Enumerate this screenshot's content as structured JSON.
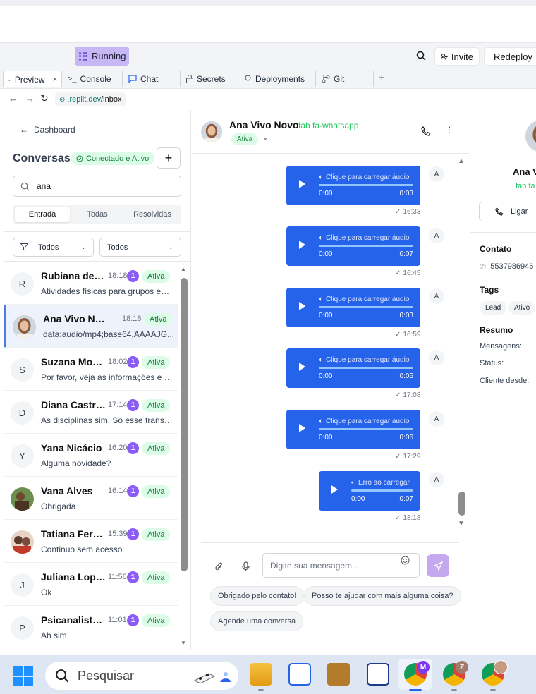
{
  "replit": {
    "running_label": "Running",
    "invite_label": "Invite",
    "redeploy_label": "Redeploy",
    "tabs": [
      {
        "label": "Preview"
      },
      {
        "label": "Console"
      },
      {
        "label": "Chat"
      },
      {
        "label": "Secrets"
      },
      {
        "label": "Deployments"
      },
      {
        "label": "Git"
      }
    ],
    "url_domain": ".replit.dev",
    "url_path": "/inbox"
  },
  "sidebar": {
    "back_label": "Dashboard",
    "title": "Conversas",
    "status_badge": "Conectado e Ativo",
    "search_value": "ana",
    "subtabs": [
      "Entrada",
      "Todas",
      "Resolvidas"
    ],
    "filter1": "Todos",
    "filter2": "Todos",
    "conversations": [
      {
        "initial": "R",
        "name": "Rubiana de P...",
        "time": "18:18",
        "badge": "1",
        "status": "Ativa",
        "preview": "Atividades físicas para grupos esp..."
      },
      {
        "initial": "",
        "name": "Ana Vivo Novo",
        "time": "18:18",
        "badge": "",
        "status": "Ativa",
        "preview": "data:audio/mp4;base64,AAAAJG..."
      },
      {
        "initial": "S",
        "name": "Suzana Moura",
        "time": "18:02",
        "badge": "1",
        "status": "Ativa",
        "preview": "Por favor, veja as informações e c..."
      },
      {
        "initial": "D",
        "name": "Diana Castro ...",
        "time": "17:14",
        "badge": "1",
        "status": "Ativa",
        "preview": "As disciplinas sim. Só esse transto..."
      },
      {
        "initial": "Y",
        "name": "Yana Nicácio",
        "time": "16:20",
        "badge": "1",
        "status": "Ativa",
        "preview": "Alguma novidade?"
      },
      {
        "initial": "",
        "name": "Vana Alves",
        "time": "16:14",
        "badge": "1",
        "status": "Ativa",
        "preview": "Obrigada"
      },
      {
        "initial": "",
        "name": "Tatiana Ferrei...",
        "time": "15:39",
        "badge": "1",
        "status": "Ativa",
        "preview": "Continuo sem acesso"
      },
      {
        "initial": "J",
        "name": "Juliana Lopes...",
        "time": "11:56",
        "badge": "1",
        "status": "Ativa",
        "preview": "Ok"
      },
      {
        "initial": "P",
        "name": "Psicanalista C...",
        "time": "11:01",
        "badge": "1",
        "status": "Ativa",
        "preview": "Ah sim"
      }
    ]
  },
  "chat": {
    "contact_name": "Ana Vivo Novo",
    "channel_label": "fab fa-whatsapp",
    "status": "Ativa",
    "messages": [
      {
        "label": "Clique para carregar áudio",
        "start": "0:00",
        "duration": "0:03",
        "time": "16:33",
        "sender": "A"
      },
      {
        "label": "Clique para carregar áudio",
        "start": "0:00",
        "duration": "0:07",
        "time": "16:45",
        "sender": "A"
      },
      {
        "label": "Clique para carregar áudio",
        "start": "0:00",
        "duration": "0:03",
        "time": "16:59",
        "sender": "A"
      },
      {
        "label": "Clique para carregar áudio",
        "start": "0:00",
        "duration": "0:05",
        "time": "17:08",
        "sender": "A"
      },
      {
        "label": "Clique para carregar áudio",
        "start": "0:00",
        "duration": "0:06",
        "time": "17:29",
        "sender": "A"
      },
      {
        "label": "Erro ao carregar",
        "start": "0:00",
        "duration": "0:07",
        "time": "18:18",
        "sender": "A"
      }
    ],
    "input_placeholder": "Digite sua mensagem...",
    "quick_replies": [
      "Obrigado pelo contato!",
      "Posso te ajudar com mais alguma coisa?",
      "Agende uma conversa"
    ]
  },
  "contact_panel": {
    "name": "Ana V",
    "channel": "fab fa",
    "call_label": "Ligar",
    "contact_heading": "Contato",
    "phone": "5537986946",
    "tags_heading": "Tags",
    "tags": [
      "Lead",
      "Ativo"
    ],
    "summary_heading": "Resumo",
    "summary_rows": [
      "Mensagens:",
      "Status:",
      "Cliente desde:"
    ]
  },
  "taskbar": {
    "search_placeholder": "Pesquisar",
    "profile_badges": [
      "M",
      "Z"
    ]
  },
  "colors": {
    "accent_purple": "#8b5cf6",
    "bubble_blue": "#2563eb",
    "active_green": "#15803d",
    "running_bg": "#c7b8f5"
  }
}
